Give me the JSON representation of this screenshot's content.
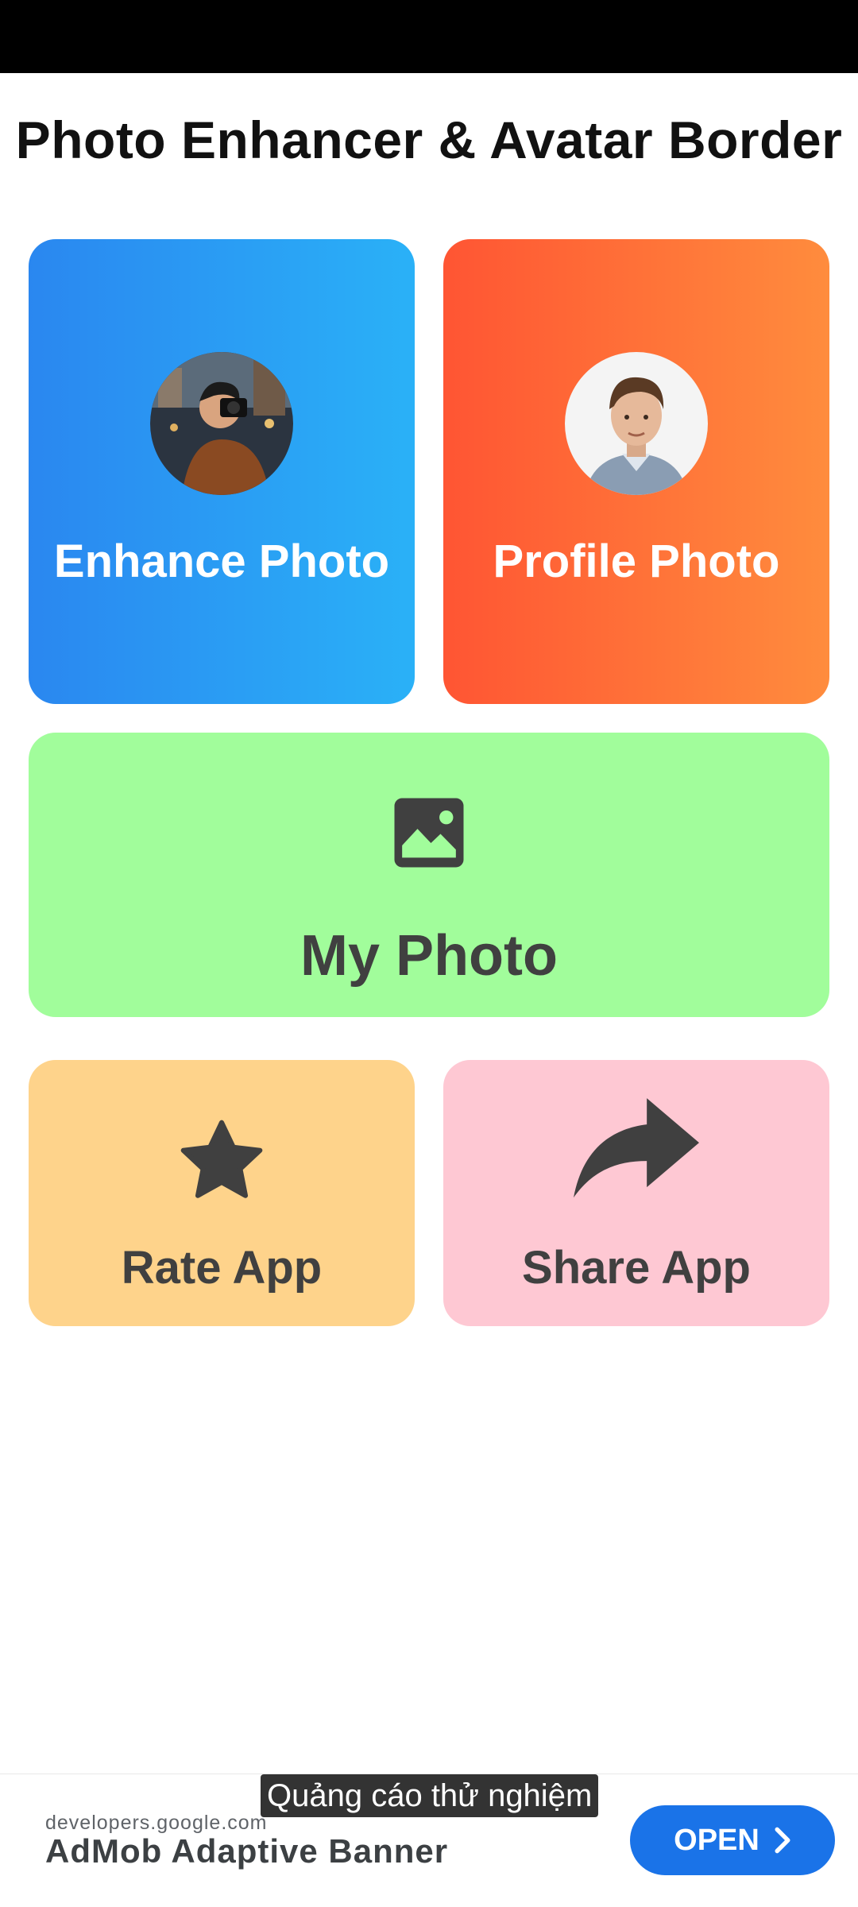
{
  "app": {
    "title": "Photo Enhancer & Avatar Border"
  },
  "cards": {
    "enhance": {
      "label": "Enhance Photo"
    },
    "profile": {
      "label": "Profile Photo"
    },
    "my_photo": {
      "label": "My Photo",
      "icon": "image-icon"
    },
    "rate": {
      "label": "Rate App",
      "icon": "star-icon"
    },
    "share": {
      "label": "Share App",
      "icon": "share-icon"
    }
  },
  "ad": {
    "tag": "Quảng cáo thử nghiệm",
    "domain": "developers.google.com",
    "headline": "AdMob Adaptive Banner",
    "button_label": "OPEN"
  },
  "colors": {
    "enhance_gradient": [
      "#2a87f0",
      "#2ab1f7"
    ],
    "profile_gradient": [
      "#ff5533",
      "#ff8c3d"
    ],
    "my_photo_bg": "#a1fd9b",
    "rate_bg": "#fed38b",
    "share_bg": "#fec8d3",
    "ad_button": "#1a73e8"
  }
}
